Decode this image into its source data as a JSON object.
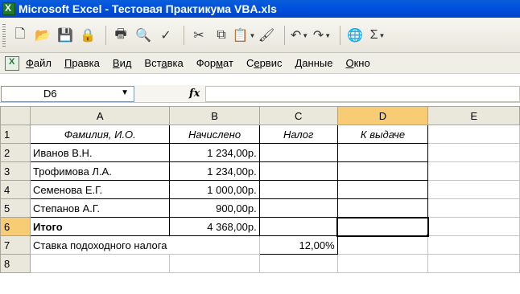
{
  "window": {
    "title": "Microsoft Excel - Тестовая Практикума VBA.xls"
  },
  "toolbar": {
    "icons": [
      "new-icon",
      "open-icon",
      "save-icon",
      "permission-icon",
      "print-icon",
      "print-preview-icon",
      "spelling-icon",
      "cut-icon",
      "copy-icon",
      "paste-icon",
      "format-painter-icon",
      "undo-icon",
      "redo-icon",
      "hyperlink-icon",
      "autosum-icon"
    ]
  },
  "menu": {
    "items": [
      {
        "pre": "",
        "ul": "Ф",
        "post": "айл"
      },
      {
        "pre": "",
        "ul": "П",
        "post": "равка"
      },
      {
        "pre": "",
        "ul": "В",
        "post": "ид"
      },
      {
        "pre": "Вст",
        "ul": "а",
        "post": "вка"
      },
      {
        "pre": "Фор",
        "ul": "м",
        "post": "ат"
      },
      {
        "pre": "С",
        "ul": "е",
        "post": "рвис"
      },
      {
        "pre": "",
        "ul": "Д",
        "post": "анные"
      },
      {
        "pre": "",
        "ul": "О",
        "post": "кно"
      }
    ]
  },
  "formula_bar": {
    "name_box": "D6",
    "fx": "fx",
    "value": ""
  },
  "sheet": {
    "columns": [
      "A",
      "B",
      "C",
      "D",
      "E"
    ],
    "selected_column": "D",
    "selected_row": "6",
    "rows": [
      {
        "n": "1",
        "A": "Фамилия, И.О.",
        "B": "Начислено",
        "C": "Налог",
        "D": "К выдаче",
        "E": ""
      },
      {
        "n": "2",
        "A": "Иванов В.Н.",
        "B": "1 234,00р.",
        "C": "",
        "D": "",
        "E": ""
      },
      {
        "n": "3",
        "A": "Трофимова Л.А.",
        "B": "1 234,00р.",
        "C": "",
        "D": "",
        "E": ""
      },
      {
        "n": "4",
        "A": "Семенова Е.Г.",
        "B": "1 000,00р.",
        "C": "",
        "D": "",
        "E": ""
      },
      {
        "n": "5",
        "A": "Степанов А.Г.",
        "B": "900,00р.",
        "C": "",
        "D": "",
        "E": ""
      },
      {
        "n": "6",
        "A": "Итого",
        "B": "4 368,00р.",
        "C": "",
        "D": "",
        "E": ""
      },
      {
        "n": "7",
        "A": "Ставка подоходного налога",
        "B": "",
        "C": "12,00%",
        "D": "",
        "E": ""
      },
      {
        "n": "8",
        "A": "",
        "B": "",
        "C": "",
        "D": "",
        "E": ""
      }
    ]
  }
}
